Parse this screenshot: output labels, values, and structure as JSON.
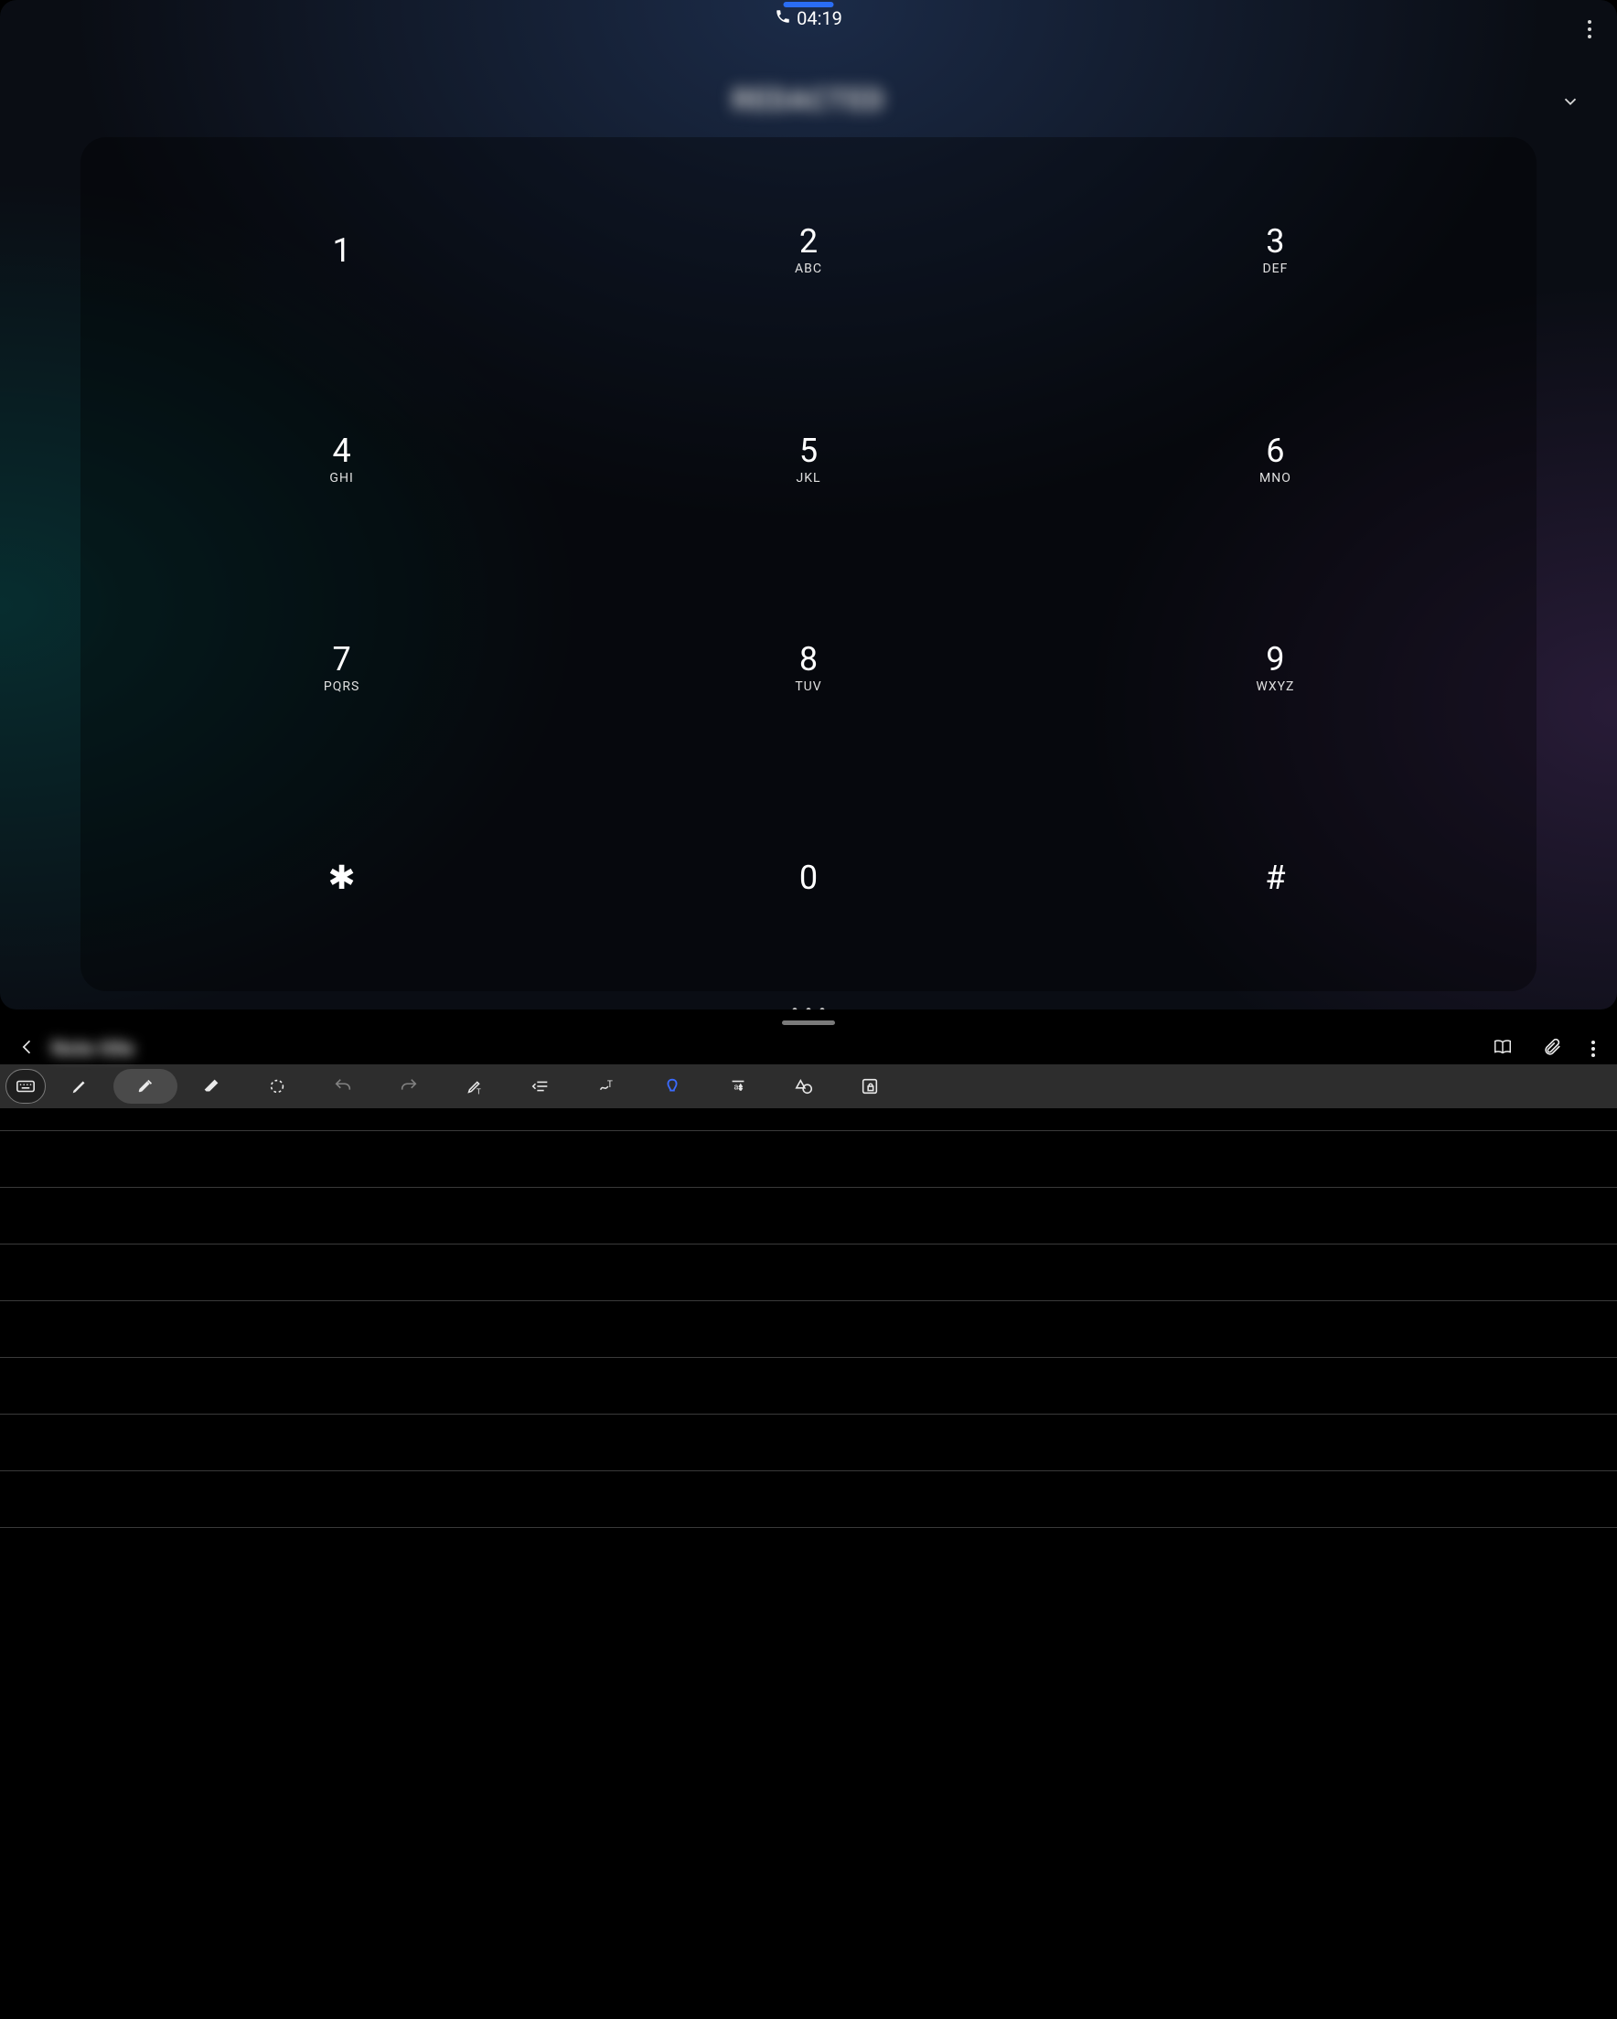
{
  "phone": {
    "call_duration": "04:19",
    "caller_name": "REDACTED",
    "keypad": [
      {
        "digit": "1",
        "sub": ""
      },
      {
        "digit": "2",
        "sub": "ABC"
      },
      {
        "digit": "3",
        "sub": "DEF"
      },
      {
        "digit": "4",
        "sub": "GHI"
      },
      {
        "digit": "5",
        "sub": "JKL"
      },
      {
        "digit": "6",
        "sub": "MNO"
      },
      {
        "digit": "7",
        "sub": "PQRS"
      },
      {
        "digit": "8",
        "sub": "TUV"
      },
      {
        "digit": "9",
        "sub": "WXYZ"
      },
      {
        "digit": "✱",
        "sub": ""
      },
      {
        "digit": "0",
        "sub": ""
      },
      {
        "digit": "#",
        "sub": ""
      }
    ]
  },
  "notes": {
    "title": "Note title",
    "ruled_line_count": 8,
    "tools": [
      {
        "name": "keyboard",
        "state": "outlined"
      },
      {
        "name": "pen",
        "state": ""
      },
      {
        "name": "highlighter",
        "state": "selected"
      },
      {
        "name": "eraser",
        "state": ""
      },
      {
        "name": "lasso-select",
        "state": ""
      },
      {
        "name": "undo",
        "state": "disabled"
      },
      {
        "name": "redo",
        "state": "disabled"
      },
      {
        "name": "convert-text",
        "state": ""
      },
      {
        "name": "align",
        "state": ""
      },
      {
        "name": "straighten",
        "state": ""
      },
      {
        "name": "easy-writing",
        "state": "accent"
      },
      {
        "name": "auto-format",
        "state": ""
      },
      {
        "name": "shape",
        "state": ""
      },
      {
        "name": "lock-canvas",
        "state": ""
      }
    ]
  }
}
